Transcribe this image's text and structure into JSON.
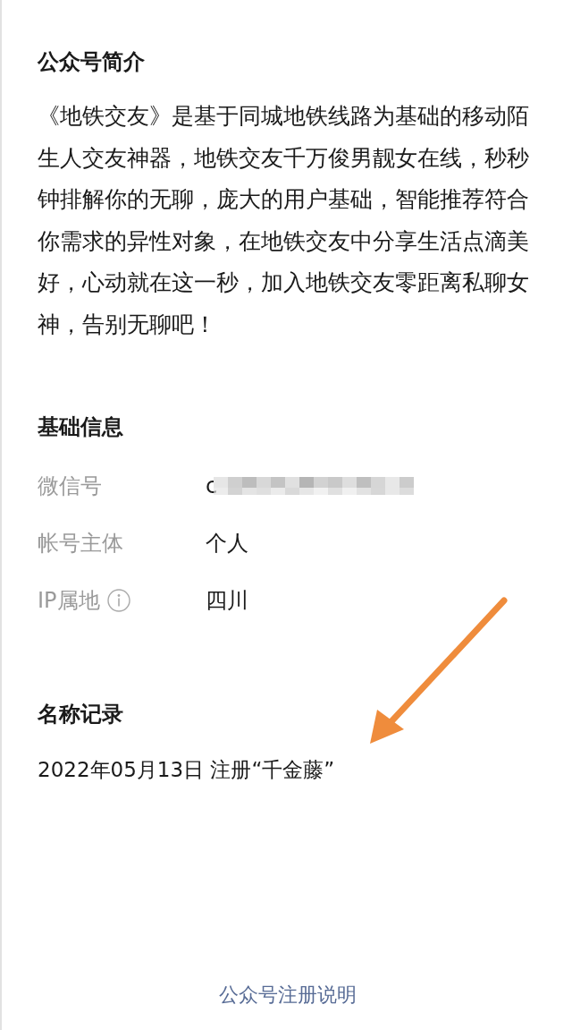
{
  "intro": {
    "title": "公众号简介",
    "text": "《地铁交友》是基于同城地铁线路为基础的移动陌生人交友神器，地铁交友千万俊男靓女在线，秒秒钟排解你的无聊，庞大的用户基础，智能推荐符合你需求的异性对象，在地铁交友中分享生活点滴美好，心动就在这一秒，加入地铁交友零距离私聊女神，告别无聊吧！"
  },
  "basic_info": {
    "title": "基础信息",
    "rows": [
      {
        "label": "微信号",
        "value": "c",
        "kind": "redacted"
      },
      {
        "label": "帐号主体",
        "value": "个人",
        "kind": "plain"
      },
      {
        "label": "IP属地",
        "value": "四川",
        "kind": "info"
      }
    ]
  },
  "name_history": {
    "title": "名称记录",
    "records": [
      "2022年05月13日 注册“千金藤”"
    ]
  },
  "footer_link": "公众号注册说明"
}
